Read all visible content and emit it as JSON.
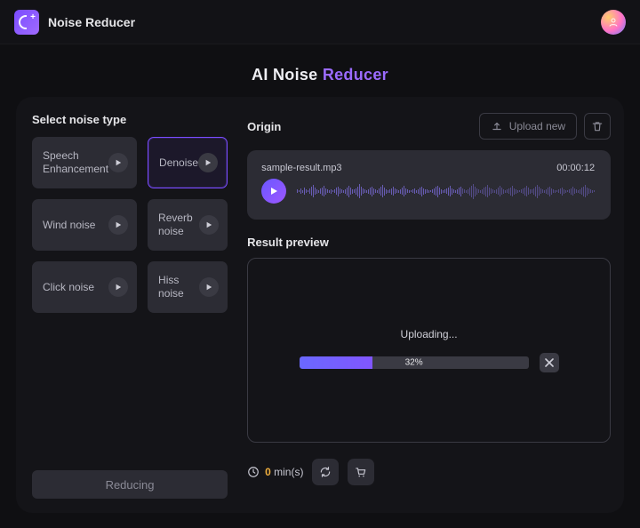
{
  "header": {
    "app_name": "Noise Reducer"
  },
  "heading": {
    "w1": "AI",
    "w2": "Noise",
    "w3": "Reducer"
  },
  "left": {
    "title": "Select noise type",
    "types": [
      {
        "label": "Speech Enhancement"
      },
      {
        "label": "Denoise"
      },
      {
        "label": "Wind noise"
      },
      {
        "label": "Reverb noise"
      },
      {
        "label": "Click noise"
      },
      {
        "label": "Hiss noise"
      }
    ],
    "selected_index": 1,
    "reduce_label": "Reducing"
  },
  "origin": {
    "title": "Origin",
    "upload_label": "Upload new",
    "file_name": "sample-result.mp3",
    "duration": "00:00:12"
  },
  "result": {
    "title": "Result preview",
    "status_label": "Uploading...",
    "progress_pct": 32,
    "progress_label": "32%"
  },
  "credits": {
    "amount": "0",
    "unit": "min(s)"
  }
}
